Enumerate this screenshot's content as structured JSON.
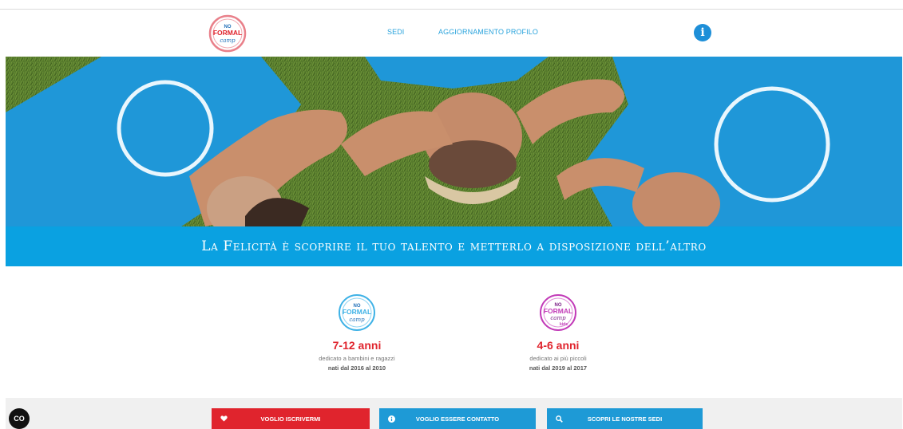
{
  "header": {
    "logo_text": "NO FORMAL camp",
    "nav": [
      {
        "label": "SEDI"
      },
      {
        "label": "AGGIORNAMENTO PROFILO"
      }
    ],
    "info_glyph": "i"
  },
  "hero": {
    "tagline": "La Felicità è scoprire il tuo talento e metterlo a disposizione dell’altro"
  },
  "programs": [
    {
      "logo_text": "NO FORMAL camp",
      "title": "7-12 anni",
      "description": "dedicato a bambini e ragazzi",
      "years": "nati dal 2016 al 2010"
    },
    {
      "logo_text": "NO FORMAL camp kids",
      "title": "4-6 anni",
      "description": "dedicato ai più piccoli",
      "years": "nati dal 2019 al 2017"
    }
  ],
  "cta": [
    {
      "label": "VOGLIO ISCRIVERMI",
      "icon": "heart-icon"
    },
    {
      "label": "VOGLIO ESSERE CONTATTO",
      "icon": "info-icon"
    },
    {
      "label": "SCOPRI LE NOSTRE SEDI",
      "icon": "search-icon"
    }
  ],
  "cookie_button": {
    "label": "CO"
  },
  "colors": {
    "primary_blue": "#0aa1e1",
    "accent_red": "#e0242d",
    "button_blue": "#1e9ad6"
  }
}
